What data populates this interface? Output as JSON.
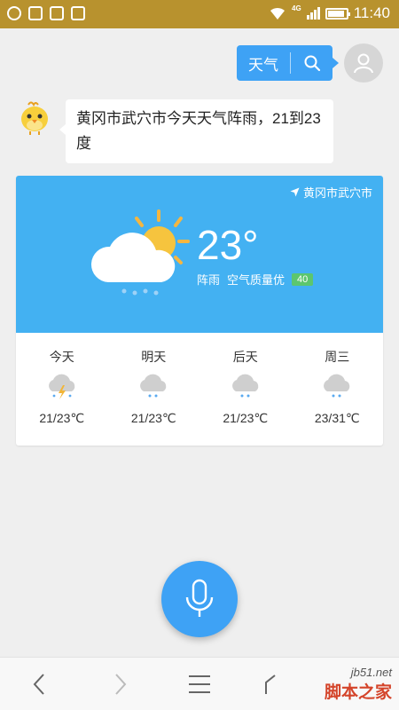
{
  "status_bar": {
    "time": "11:40",
    "network": "4G",
    "battery_level": 0.9
  },
  "chat": {
    "query": "天气",
    "answer": "黄冈市武穴市今天天气阵雨，21到23度"
  },
  "weather": {
    "location": "黄冈市武穴市",
    "temperature": "23°",
    "condition": "阵雨",
    "air_quality_label": "空气质量优",
    "aqi": "40",
    "forecast": [
      {
        "day": "今天",
        "icon": "thunder-shower-icon",
        "temp": "21/23℃"
      },
      {
        "day": "明天",
        "icon": "light-rain-icon",
        "temp": "21/23℃"
      },
      {
        "day": "后天",
        "icon": "light-rain-icon",
        "temp": "21/23℃"
      },
      {
        "day": "周三",
        "icon": "light-rain-icon",
        "temp": "23/31℃"
      }
    ]
  },
  "colors": {
    "accent": "#3ea2f5",
    "weather_bg": "#43b1f2",
    "status_bar": "#b8922e",
    "aqi_badge": "#5cc66e"
  },
  "watermark": {
    "url": "jb51.net",
    "name": "脚本之家"
  }
}
